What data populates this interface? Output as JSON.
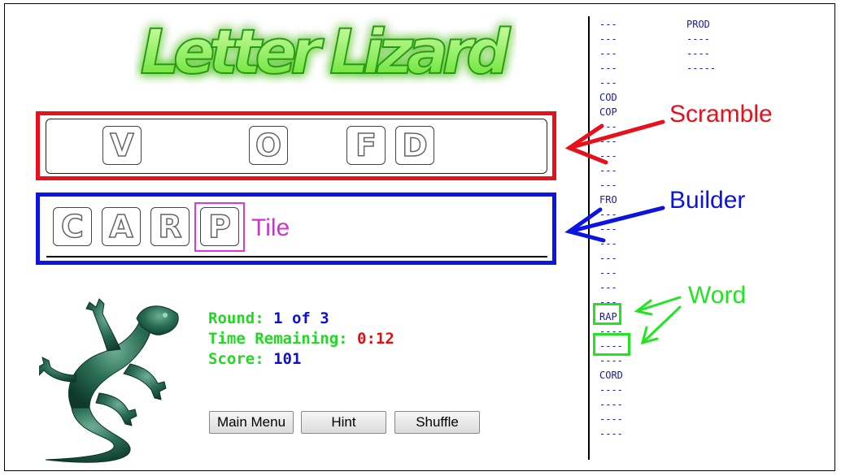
{
  "title": "Letter Lizard",
  "scramble_tiles": [
    {
      "letter": "V"
    },
    {
      "letter": "O"
    },
    {
      "letter": "F"
    },
    {
      "letter": "D"
    }
  ],
  "builder_tiles": [
    {
      "letter": "C"
    },
    {
      "letter": "A"
    },
    {
      "letter": "R"
    },
    {
      "letter": "P"
    }
  ],
  "annotations": {
    "scramble": "Scramble",
    "builder": "Builder",
    "tile": "Tile",
    "word": "Word"
  },
  "status": {
    "round_label": "Round:",
    "round_value": "1 of 3",
    "time_label": "Time Remaining:",
    "time_value": "0:12",
    "score_label": "Score:",
    "score_value": "101"
  },
  "buttons": {
    "main_menu": "Main Menu",
    "hint": "Hint",
    "shuffle": "Shuffle"
  },
  "word_list": {
    "column1": [
      "---",
      "---",
      "---",
      "---",
      "---",
      "COD",
      "COP",
      "---",
      "---",
      "---",
      "---",
      "---",
      "FRO",
      "---",
      "---",
      "---",
      "---",
      "---",
      "---",
      "---",
      "RAP",
      "----",
      "----",
      "----",
      "CORD",
      "----",
      "----",
      "----",
      "----"
    ],
    "column2": [
      "PROD",
      "----",
      "----",
      "-----"
    ]
  },
  "colors": {
    "scramble": "#e8101a",
    "builder": "#0b14e0",
    "tile": "#d030d0",
    "word": "#22e522",
    "title_fill": "#8af24a",
    "lizard": "#1f5a45"
  }
}
